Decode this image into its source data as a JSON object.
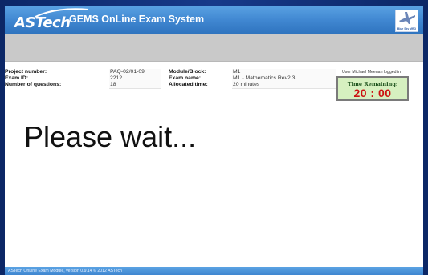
{
  "header": {
    "logo_text": "ASTech",
    "title": "GEMS OnLine Exam System",
    "badge_text": "Blue Sky MRO"
  },
  "exam_info": {
    "project_number_label": "Project number:",
    "project_number_value": "PAQ-02/01-09",
    "exam_id_label": "Exam ID:",
    "exam_id_value": "2212",
    "num_questions_label": "Number of questions:",
    "num_questions_value": "18",
    "module_block_label": "Module/Block:",
    "module_block_value": "M1",
    "exam_name_label": "Exam name:",
    "exam_name_value": "M1 - Mathematics Rev2.3",
    "allocated_time_label": "Allocated time:",
    "allocated_time_value": "20 minutes"
  },
  "user_status": "User Michael Meenan logged in",
  "timer": {
    "label": "Time Remaining:",
    "value": "20 : 00"
  },
  "main": {
    "message": "Please wait..."
  },
  "footer": {
    "text": "ASTech OnLine Exam Module, version 0.9.14 © 2012 ASTech"
  },
  "colors": {
    "header_blue": "#3f86d0",
    "timer_bg": "#d6f0c0",
    "timer_text": "#cc1111"
  }
}
